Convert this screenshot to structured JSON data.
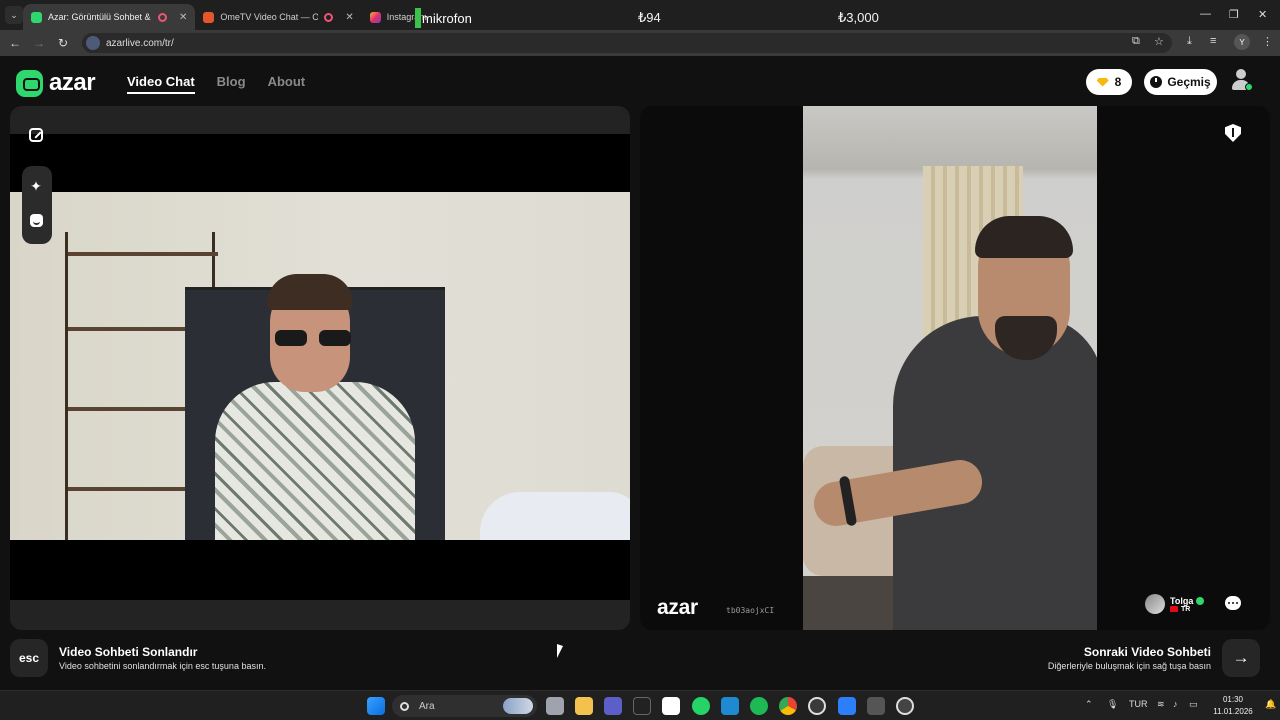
{
  "browser": {
    "tabs": [
      {
        "title": "Azar: Görüntülü Sohbet & V",
        "active": true
      },
      {
        "title": "OmeTV Video Chat — Ome",
        "active": false
      },
      {
        "title": "Instagram",
        "active": false
      }
    ],
    "overlay": {
      "mic_label": "mikrofon",
      "price_a": "₺94",
      "price_b": "₺3,000"
    },
    "url": "azarlive.com/tr/",
    "profile_initial": "Y"
  },
  "header": {
    "logo_text": "azar",
    "nav": [
      {
        "label": "Video Chat",
        "active": true
      },
      {
        "label": "Blog",
        "active": false
      },
      {
        "label": "About",
        "active": false
      }
    ],
    "gems": "8",
    "history_label": "Geçmiş"
  },
  "peer": {
    "watermark": "azar",
    "session_id": "tb03aojxCI",
    "name": "Tolga",
    "country": "TR"
  },
  "footer": {
    "esc_key": "esc",
    "end_title": "Video Sohbeti Sonlandır",
    "end_desc": "Video sohbetini sonlandırmak için esc tuşuna basın.",
    "next_title": "Sonraki Video Sohbeti",
    "next_desc": "Diğerleriyle buluşmak için sağ tuşa basın",
    "next_key": "→"
  },
  "taskbar": {
    "search_placeholder": "Ara",
    "language": "TUR",
    "time": "01:30",
    "date": "11.01.2026"
  },
  "colors": {
    "brand": "#2fd86f",
    "gem": "#f5b90f",
    "background": "#111111"
  }
}
